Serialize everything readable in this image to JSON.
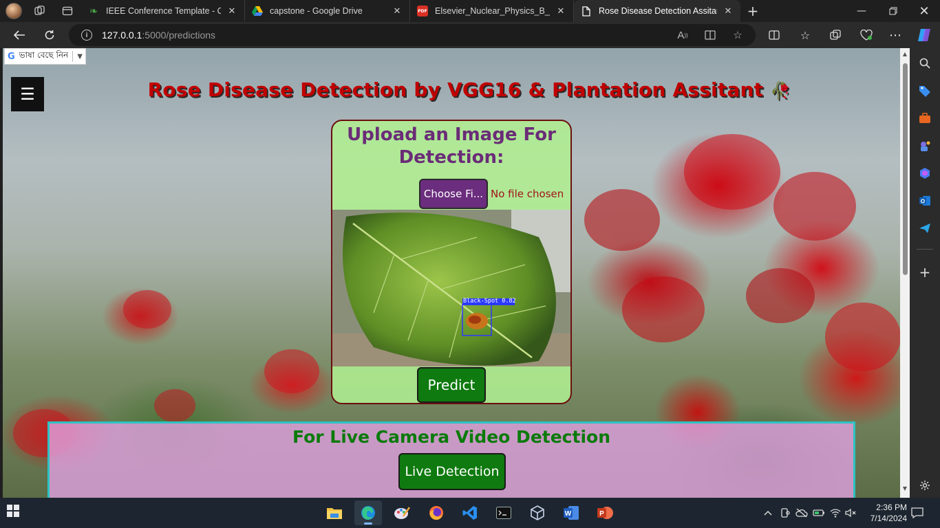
{
  "browser": {
    "tabs": [
      {
        "title": "IEEE Conference Template - Onlin",
        "favicon": "overleaf-icon",
        "active": false
      },
      {
        "title": "capstone - Google Drive",
        "favicon": "google-drive-icon",
        "active": false
      },
      {
        "title": "Elsevier_Nuclear_Physics_B_journ",
        "favicon": "pdf-icon",
        "active": false
      },
      {
        "title": "Rose Disease Detection Assitant",
        "favicon": "page-icon",
        "active": true
      }
    ],
    "url_host": "127.0.0.1",
    "url_path": ":5000/predictions"
  },
  "page": {
    "translate_widget": {
      "label": "ভাষা বেছে নিন",
      "caret": "▼"
    },
    "menu_icon": "☰",
    "title": "Rose Disease Detection by VGG16 & Plantation Assitant",
    "title_emoji": "🥀",
    "upload": {
      "heading": "Upload an Image For Detection:",
      "choose_button": "Choose Fi...",
      "file_status": "No file chosen",
      "detection_label": "Black-Spot 0.82",
      "predict_button": "Predict"
    },
    "live": {
      "heading": "For Live Camera Video Detection",
      "button": "Live Detection"
    }
  },
  "taskbar": {
    "time": "2:36 PM",
    "date": "7/14/2024"
  },
  "colors": {
    "title": "#c00000",
    "upload_heading": "#6a2c77",
    "button_purple": "#6b2d7d",
    "button_green": "#0f7a0f",
    "live_heading": "#0a7a0a",
    "live_border": "#2cc3c3"
  }
}
